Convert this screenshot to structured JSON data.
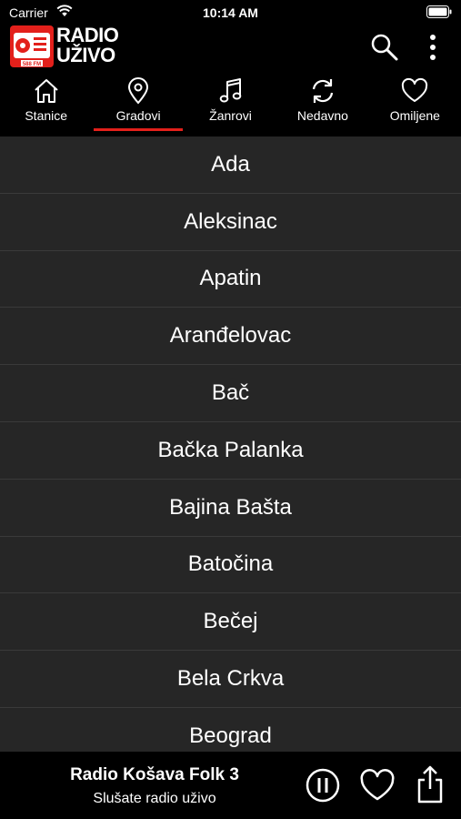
{
  "status_bar": {
    "carrier": "Carrier",
    "time": "10:14 AM"
  },
  "app": {
    "logo_line1": "RADIO",
    "logo_line2": "UŽIVO",
    "logo_badge": "588 FM"
  },
  "tabs": [
    {
      "label": "Stanice",
      "icon": "home-icon",
      "active": false
    },
    {
      "label": "Gradovi",
      "icon": "location-pin-icon",
      "active": true
    },
    {
      "label": "Žanrovi",
      "icon": "music-note-icon",
      "active": false
    },
    {
      "label": "Nedavno",
      "icon": "refresh-icon",
      "active": false
    },
    {
      "label": "Omiljene",
      "icon": "heart-icon",
      "active": false
    }
  ],
  "accent_color": "#e3201b",
  "cities": [
    "Ada",
    "Aleksinac",
    "Apatin",
    "Aranđelovac",
    "Bač",
    "Bačka Palanka",
    "Bajina Bašta",
    "Batočina",
    "Bečej",
    "Bela Crkva",
    "Beograd"
  ],
  "player": {
    "station": "Radio Košava Folk 3",
    "status": "Slušate radio uživo"
  }
}
